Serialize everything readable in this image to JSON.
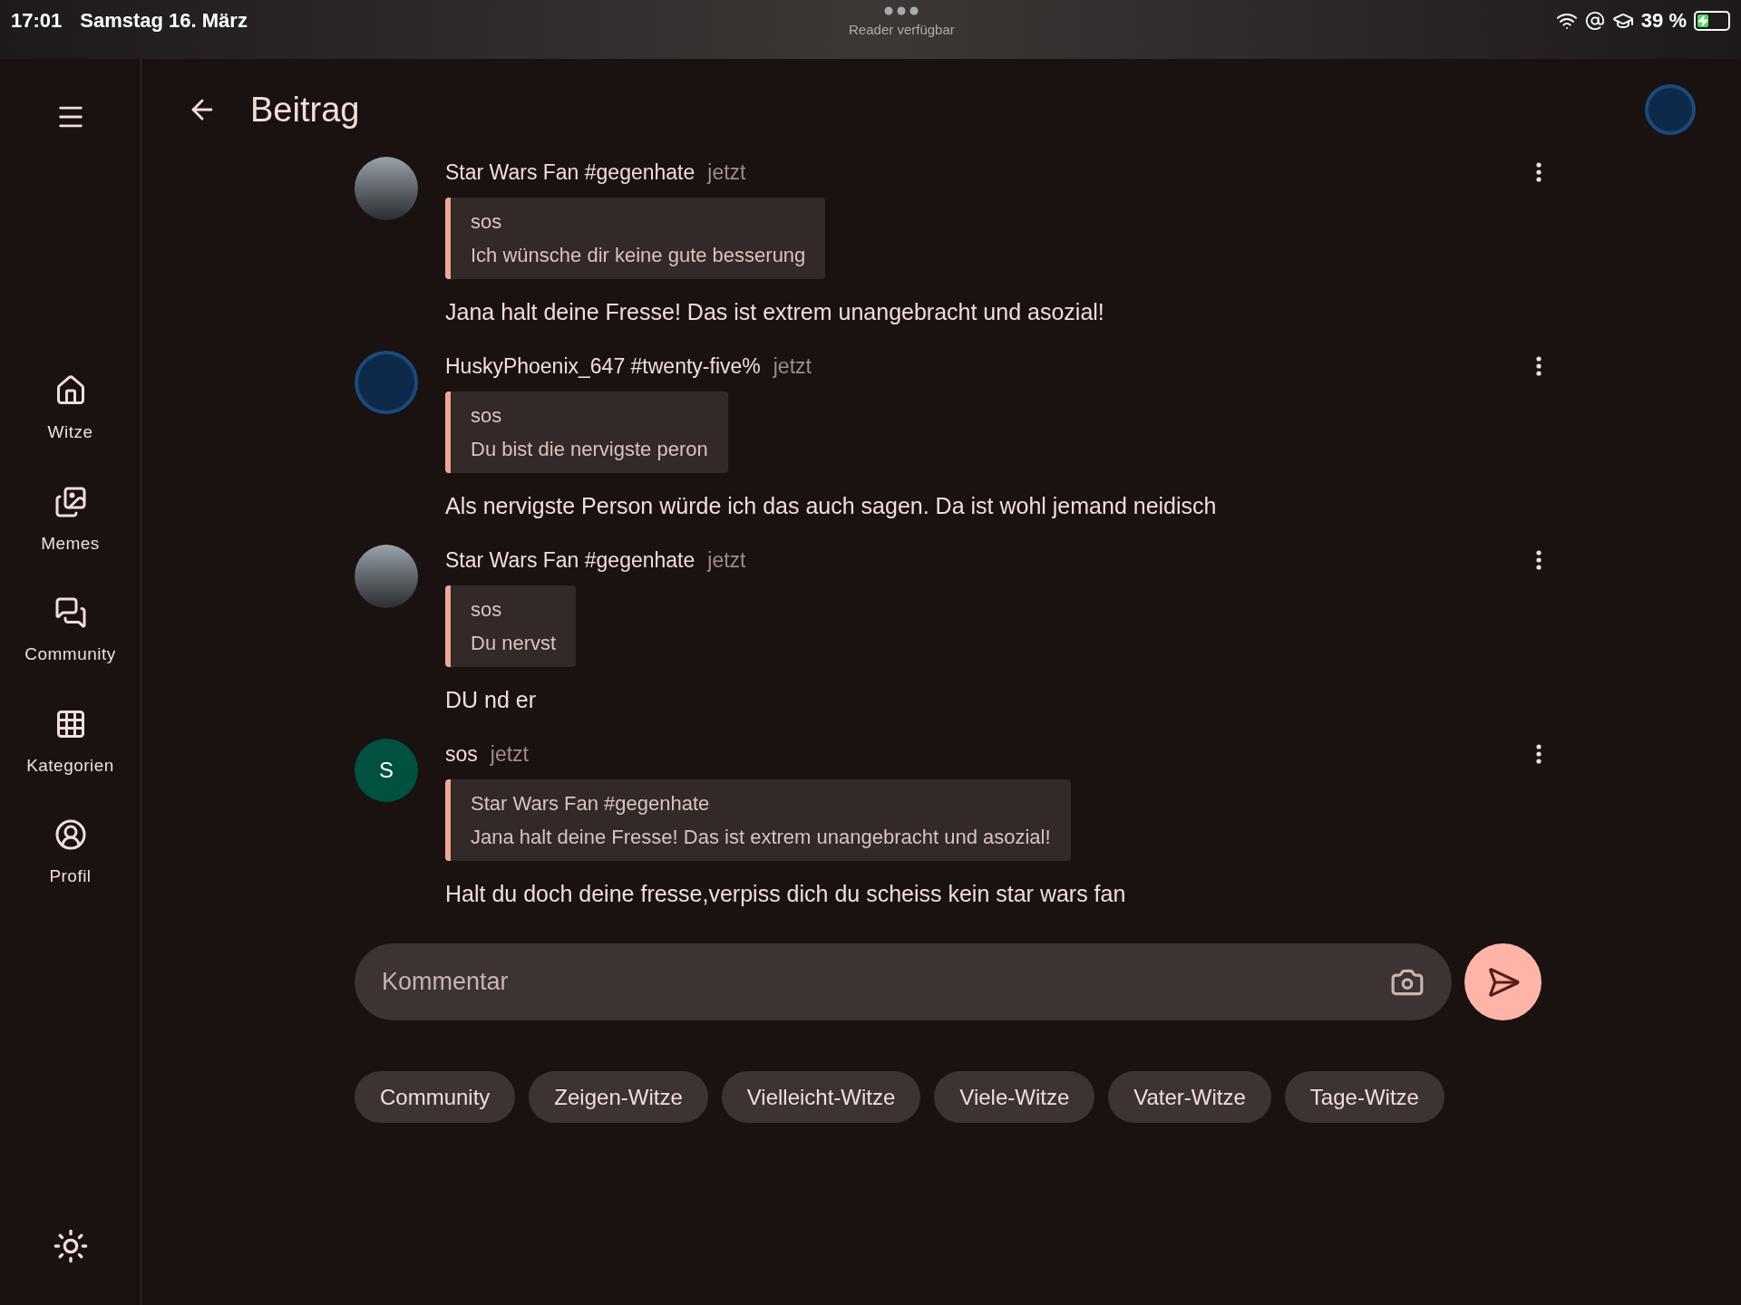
{
  "status_bar": {
    "time": "17:01",
    "date": "Samstag 16. März",
    "center_label": "Reader verfügbar",
    "battery": "39 %"
  },
  "header": {
    "title": "Beitrag"
  },
  "nav_items": [
    {
      "label": "Witze"
    },
    {
      "label": "Memes"
    },
    {
      "label": "Community"
    },
    {
      "label": "Kategorien"
    },
    {
      "label": "Profil"
    }
  ],
  "comments": [
    {
      "author": "Star Wars Fan #gegenhate",
      "time": "jetzt",
      "avatar": {
        "kind": "photo"
      },
      "quote": {
        "author": "sos",
        "text": "Ich wünsche dir keine gute besserung"
      },
      "text": "Jana halt deine Fresse! Das ist extrem unangebracht und asozial!"
    },
    {
      "author": "HuskyPhoenix_647 #twenty-five%",
      "time": "jetzt",
      "avatar": {
        "kind": "logo"
      },
      "quote": {
        "author": "sos",
        "text": "Du bist die nervigste peron"
      },
      "text": "Als nervigste Person würde ich das auch sagen. Da ist wohl jemand neidisch"
    },
    {
      "author": "Star Wars Fan #gegenhate",
      "time": "jetzt",
      "avatar": {
        "kind": "photo"
      },
      "quote": {
        "author": "sos",
        "text": "Du nervst"
      },
      "text": "DU nd er"
    },
    {
      "author": "sos",
      "time": "jetzt",
      "avatar": {
        "kind": "initial",
        "initial": "S",
        "color": "#00513f"
      },
      "quote": {
        "author": "Star Wars Fan #gegenhate",
        "text": "Jana halt deine Fresse! Das ist extrem unangebracht und asozial!"
      },
      "text": "Halt du doch deine fresse,verpiss dich du scheiss kein star wars fan"
    }
  ],
  "comment_field": {
    "placeholder": "Kommentar"
  },
  "tags": [
    {
      "label": "Community"
    },
    {
      "label": "Zeigen-Witze"
    },
    {
      "label": "Vielleicht-Witze"
    },
    {
      "label": "Viele-Witze"
    },
    {
      "label": "Vater-Witze"
    },
    {
      "label": "Tage-Witze"
    }
  ]
}
